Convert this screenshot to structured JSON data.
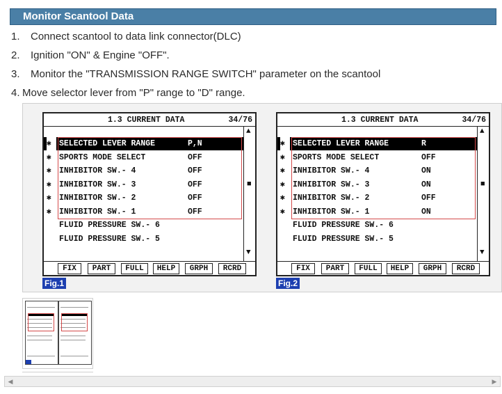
{
  "header": {
    "title": "Monitor Scantool Data"
  },
  "steps": [
    {
      "num": "1.",
      "text": "Connect scantool to data link connector(DLC)"
    },
    {
      "num": "2.",
      "text": "Ignition \"ON\" & Engine \"OFF\"."
    },
    {
      "num": "3.",
      "text": "Monitor the \"TRANSMISSION RANGE SWITCH\" parameter on the scantool"
    },
    {
      "num": "4.",
      "text": "Move selector lever from \"P\" range to \"D\" range."
    }
  ],
  "figures": [
    {
      "label": "Fig.1",
      "title": "1.3 CURRENT DATA",
      "page": "34/76",
      "rows": [
        {
          "mark": "✱",
          "name": "SELECTED LEVER RANGE",
          "value": "P,N"
        },
        {
          "mark": "✱",
          "name": "SPORTS MODE SELECT",
          "value": "OFF"
        },
        {
          "mark": "✱",
          "name": "INHIBITOR SW.- 4",
          "value": "OFF"
        },
        {
          "mark": "✱",
          "name": "INHIBITOR SW.- 3",
          "value": "OFF"
        },
        {
          "mark": "✱",
          "name": "INHIBITOR SW.- 2",
          "value": "OFF"
        },
        {
          "mark": "✱",
          "name": "INHIBITOR SW.- 1",
          "value": "OFF"
        },
        {
          "mark": "",
          "name": "FLUID PRESSURE SW.- 6",
          "value": ""
        },
        {
          "mark": "",
          "name": "FLUID PRESSURE SW.- 5",
          "value": ""
        }
      ],
      "buttons": [
        "FIX",
        "PART",
        "FULL",
        "HELP",
        "GRPH",
        "RCRD"
      ]
    },
    {
      "label": "Fig.2",
      "title": "1.3 CURRENT DATA",
      "page": "34/76",
      "rows": [
        {
          "mark": "✱",
          "name": "SELECTED LEVER RANGE",
          "value": "R"
        },
        {
          "mark": "✱",
          "name": "SPORTS MODE SELECT",
          "value": "OFF"
        },
        {
          "mark": "✱",
          "name": "INHIBITOR SW.- 4",
          "value": "ON"
        },
        {
          "mark": "✱",
          "name": "INHIBITOR SW.- 3",
          "value": "ON"
        },
        {
          "mark": "✱",
          "name": "INHIBITOR SW.- 2",
          "value": "OFF"
        },
        {
          "mark": "✱",
          "name": "INHIBITOR SW.- 1",
          "value": "ON"
        },
        {
          "mark": "",
          "name": "FLUID PRESSURE SW.- 6",
          "value": ""
        },
        {
          "mark": "",
          "name": "FLUID PRESSURE SW.- 5",
          "value": ""
        }
      ],
      "buttons": [
        "FIX",
        "PART",
        "FULL",
        "HELP",
        "GRPH",
        "RCRD"
      ]
    }
  ],
  "scroll_glyphs": {
    "up": "▲",
    "mid": "■",
    "down": "▼",
    "left": "◀",
    "right": "▶"
  },
  "icons": [
    "scroll-up-arrow-icon",
    "scroll-thumb-icon",
    "scroll-down-arrow-icon",
    "scroll-left-icon",
    "scroll-right-icon"
  ],
  "colors": {
    "header_bg": "#4a7fa6",
    "fig_label_bg": "#1d3fb0",
    "highlight_box": "#d44a4a"
  }
}
